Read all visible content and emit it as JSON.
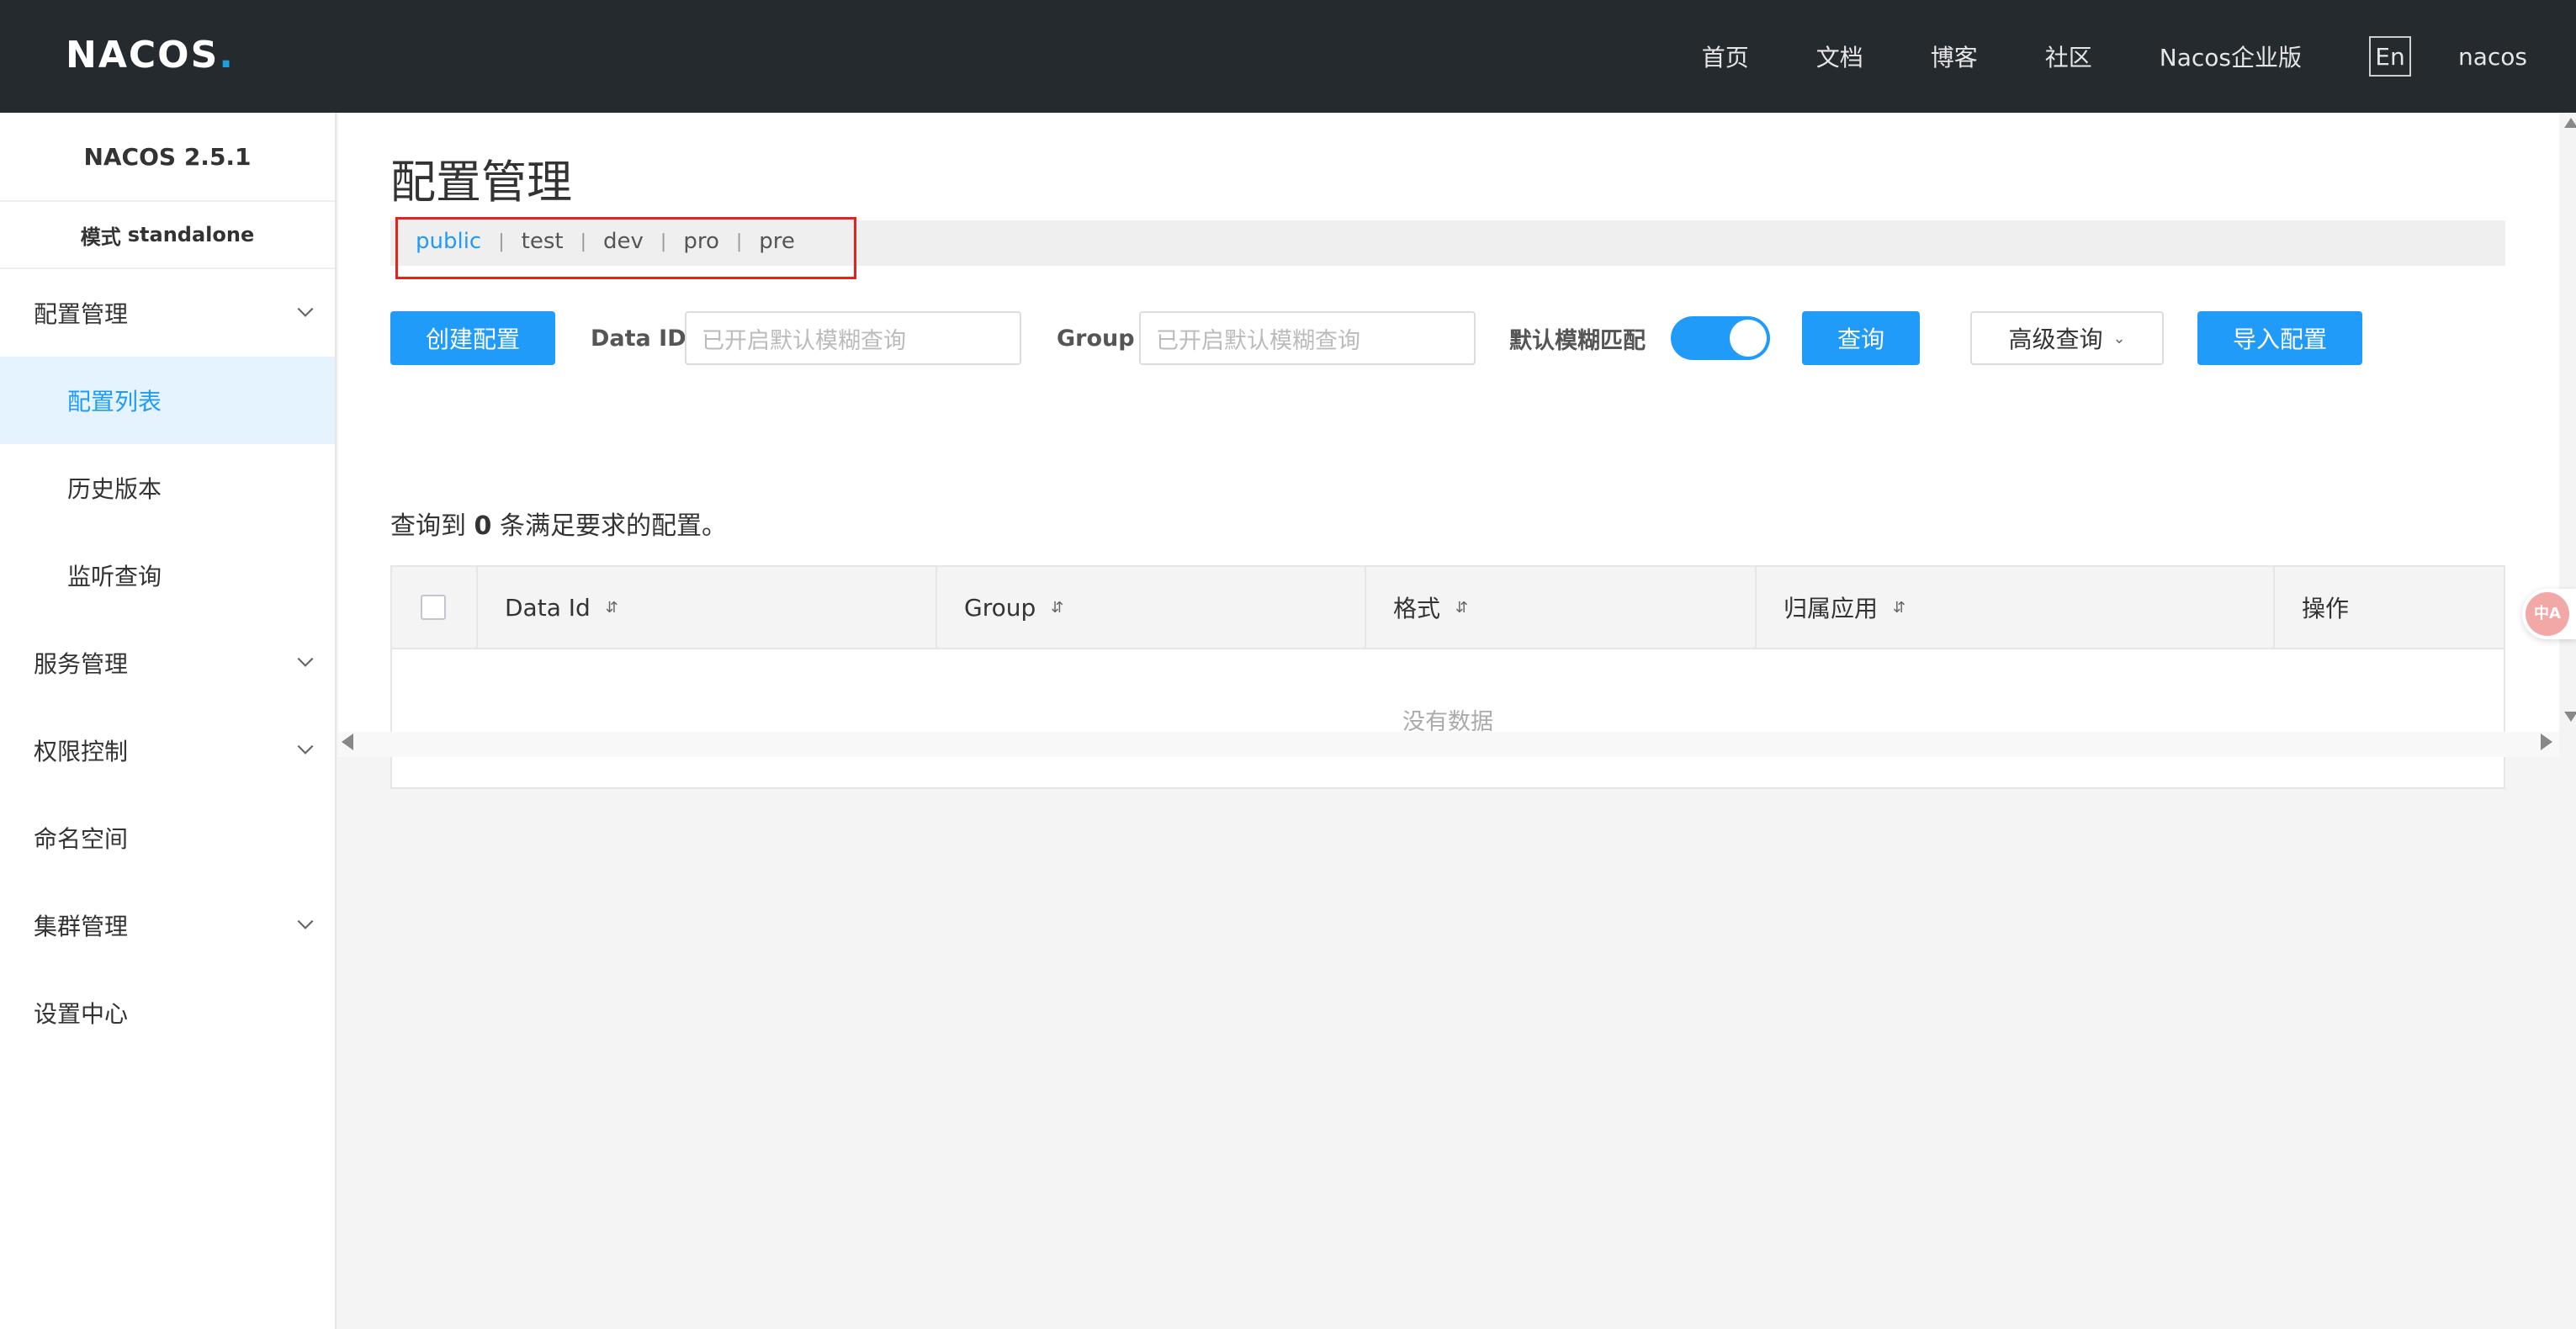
{
  "header": {
    "logo": {
      "text": "NACOS",
      "suffix": "."
    },
    "nav": [
      "首页",
      "文档",
      "博客",
      "社区",
      "Nacos企业版"
    ],
    "lang_button": "En",
    "username": "nacos"
  },
  "sidebar": {
    "version": "NACOS 2.5.1",
    "mode_label": "模式",
    "mode_value": "standalone",
    "items": [
      {
        "label": "配置管理",
        "expandable": true
      },
      {
        "label": "配置列表",
        "active": true
      },
      {
        "label": "历史版本"
      },
      {
        "label": "监听查询"
      },
      {
        "label": "服务管理",
        "expandable": true
      },
      {
        "label": "权限控制",
        "expandable": true
      },
      {
        "label": "命名空间"
      },
      {
        "label": "集群管理",
        "expandable": true
      },
      {
        "label": "设置中心"
      }
    ]
  },
  "main": {
    "title": "配置管理",
    "namespaces": [
      "public",
      "test",
      "dev",
      "pro",
      "pre"
    ],
    "active_namespace": "public",
    "toolbar": {
      "create_button": "创建配置",
      "data_id_label": "Data ID",
      "data_id_placeholder": "已开启默认模糊查询",
      "group_label": "Group",
      "group_placeholder": "已开启默认模糊查询",
      "fuzzy_label": "默认模糊匹配",
      "fuzzy_enabled": true,
      "query_button": "查询",
      "advanced_button": "高级查询",
      "import_button": "导入配置"
    },
    "result": {
      "prefix": "查询到",
      "count": "0",
      "suffix": "条满足要求的配置。"
    },
    "table": {
      "columns": [
        "Data Id",
        "Group",
        "格式",
        "归属应用",
        "操作"
      ],
      "empty_text": "没有数据"
    }
  },
  "colors": {
    "accent": "#209bfa",
    "header_bg": "#252a2f",
    "highlight_border": "#e1251b"
  },
  "translate_widget": {
    "text": "中A"
  }
}
